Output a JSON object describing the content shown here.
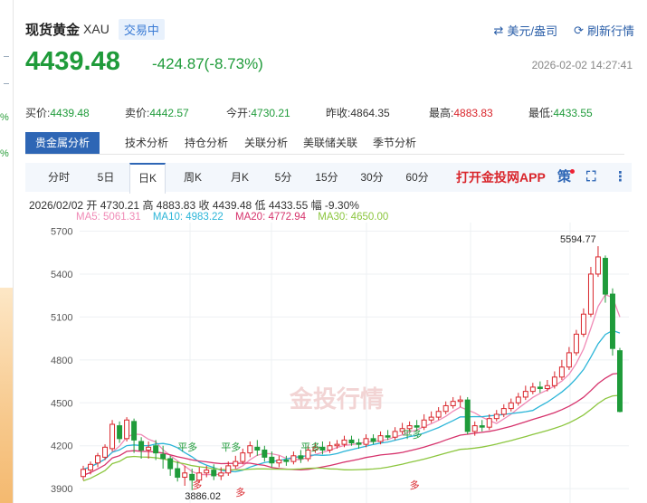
{
  "sidebar": {
    "pct_a": "%",
    "pct_b": "%"
  },
  "header": {
    "title": "现货黄金",
    "code": "XAU",
    "status": "交易中",
    "link_currency": "美元/盎司",
    "link_refresh": "刷新行情"
  },
  "quote": {
    "price": "4439.48",
    "change": "-424.87(-8.73%)",
    "time": "2026-02-02 14:27:41"
  },
  "stats": [
    {
      "label": "买价:",
      "value": "4439.48"
    },
    {
      "label": "卖价:",
      "value": "4442.57"
    },
    {
      "label": "今开:",
      "value": "4730.21"
    },
    {
      "label": "昨收:",
      "value": "4864.35"
    },
    {
      "label": "最高:",
      "value": "4883.83"
    },
    {
      "label": "最低:",
      "value": "4433.55"
    }
  ],
  "analysis_tabs": [
    "贵金属分析",
    "技术分析",
    "持仓分析",
    "关联分析",
    "美联储关联",
    "季节分析"
  ],
  "periods": [
    "分时",
    "5日",
    "日K",
    "周K",
    "月K",
    "5分",
    "15分",
    "30分",
    "60分"
  ],
  "app_link": "打开金投网APP",
  "tool_icons": {
    "strategy": "策"
  },
  "ohlc_line": "2026/02/02  开 4730.21  高 4883.83  收 4439.48  低 4433.55  幅 -9.30%",
  "ma_labels": {
    "ma5": "MA5: 5061.31",
    "ma10": "MA10: 4983.22",
    "ma20": "MA20: 4772.94",
    "ma30": "MA30: 4650.00"
  },
  "colors": {
    "up": "#d9252b",
    "down": "#1f9b3a",
    "ma5": "#f08ab6",
    "ma10": "#2bb5d8",
    "ma20": "#d6336c",
    "ma30": "#8cc63f",
    "accent": "#2e66b5"
  },
  "chart_data": {
    "type": "candlestick",
    "ylim": [
      3800,
      5760
    ],
    "yticks": [
      "5700",
      "5400",
      "5100",
      "4800",
      "4500",
      "4200",
      "3900"
    ],
    "annotations": {
      "max": "5594.77",
      "min": "3886.02"
    },
    "markers": [
      "平多",
      "平多",
      "平多",
      "平多",
      "平多",
      "多",
      "多",
      "多",
      "多"
    ],
    "watermark": "金投行情",
    "candles": [
      [
        3985,
        4035,
        4060,
        3960
      ],
      [
        4030,
        4070,
        4090,
        4000
      ],
      [
        4080,
        4130,
        4150,
        4050
      ],
      [
        4120,
        4190,
        4210,
        4100
      ],
      [
        4180,
        4350,
        4380,
        4160
      ],
      [
        4340,
        4250,
        4370,
        4220
      ],
      [
        4250,
        4380,
        4400,
        4230
      ],
      [
        4370,
        4240,
        4390,
        4150
      ],
      [
        4230,
        4170,
        4260,
        4110
      ],
      [
        4170,
        4190,
        4230,
        4110
      ],
      [
        4200,
        4150,
        4240,
        4100
      ],
      [
        4140,
        4110,
        4200,
        4040
      ],
      [
        4110,
        4040,
        4130,
        3990
      ],
      [
        4040,
        3980,
        4090,
        3950
      ],
      [
        3980,
        4010,
        4060,
        3920
      ],
      [
        4000,
        3960,
        4040,
        3890
      ],
      [
        3960,
        4010,
        4050,
        3940
      ],
      [
        4010,
        4030,
        4060,
        3980
      ],
      [
        4030,
        3990,
        4070,
        3960
      ],
      [
        3990,
        4010,
        4050,
        3960
      ],
      [
        4010,
        4060,
        4090,
        3990
      ],
      [
        4060,
        4090,
        4130,
        4040
      ],
      [
        4090,
        4150,
        4180,
        4070
      ],
      [
        4150,
        4200,
        4230,
        4120
      ],
      [
        4190,
        4170,
        4240,
        4130
      ],
      [
        4170,
        4120,
        4200,
        4090
      ],
      [
        4120,
        4080,
        4160,
        4050
      ],
      [
        4080,
        4100,
        4130,
        4050
      ],
      [
        4100,
        4090,
        4130,
        4060
      ],
      [
        4090,
        4130,
        4160,
        4070
      ],
      [
        4130,
        4110,
        4170,
        4080
      ],
      [
        4110,
        4170,
        4200,
        4090
      ],
      [
        4170,
        4190,
        4220,
        4150
      ],
      [
        4190,
        4170,
        4230,
        4140
      ],
      [
        4170,
        4200,
        4230,
        4150
      ],
      [
        4200,
        4210,
        4240,
        4180
      ],
      [
        4210,
        4240,
        4270,
        4190
      ],
      [
        4240,
        4220,
        4270,
        4200
      ],
      [
        4220,
        4210,
        4250,
        4180
      ],
      [
        4210,
        4250,
        4280,
        4190
      ],
      [
        4250,
        4230,
        4280,
        4210
      ],
      [
        4230,
        4270,
        4300,
        4210
      ],
      [
        4270,
        4260,
        4310,
        4240
      ],
      [
        4260,
        4300,
        4330,
        4240
      ],
      [
        4300,
        4320,
        4360,
        4280
      ],
      [
        4320,
        4340,
        4370,
        4300
      ],
      [
        4340,
        4330,
        4380,
        4300
      ],
      [
        4330,
        4380,
        4420,
        4310
      ],
      [
        4380,
        4400,
        4440,
        4360
      ],
      [
        4400,
        4440,
        4470,
        4380
      ],
      [
        4440,
        4480,
        4510,
        4420
      ],
      [
        4480,
        4510,
        4540,
        4460
      ],
      [
        4510,
        4520,
        4550,
        4470
      ],
      [
        4520,
        4300,
        4540,
        4280
      ],
      [
        4300,
        4340,
        4370,
        4270
      ],
      [
        4340,
        4330,
        4380,
        4300
      ],
      [
        4330,
        4390,
        4420,
        4310
      ],
      [
        4390,
        4420,
        4450,
        4370
      ],
      [
        4420,
        4460,
        4490,
        4400
      ],
      [
        4460,
        4500,
        4530,
        4440
      ],
      [
        4500,
        4540,
        4570,
        4480
      ],
      [
        4540,
        4580,
        4620,
        4520
      ],
      [
        4580,
        4610,
        4640,
        4560
      ],
      [
        4610,
        4600,
        4650,
        4570
      ],
      [
        4600,
        4620,
        4660,
        4580
      ],
      [
        4620,
        4680,
        4720,
        4600
      ],
      [
        4680,
        4750,
        4800,
        4660
      ],
      [
        4750,
        4850,
        4890,
        4730
      ],
      [
        4850,
        4980,
        5010,
        4830
      ],
      [
        4980,
        5120,
        5160,
        4960
      ],
      [
        5120,
        5400,
        5450,
        5100
      ],
      [
        5400,
        5520,
        5594.77,
        5380
      ],
      [
        5510,
        5260,
        5530,
        5200
      ],
      [
        5260,
        4880,
        5300,
        4830
      ],
      [
        4864.35,
        4439.48,
        4883.83,
        4433.55
      ]
    ]
  }
}
